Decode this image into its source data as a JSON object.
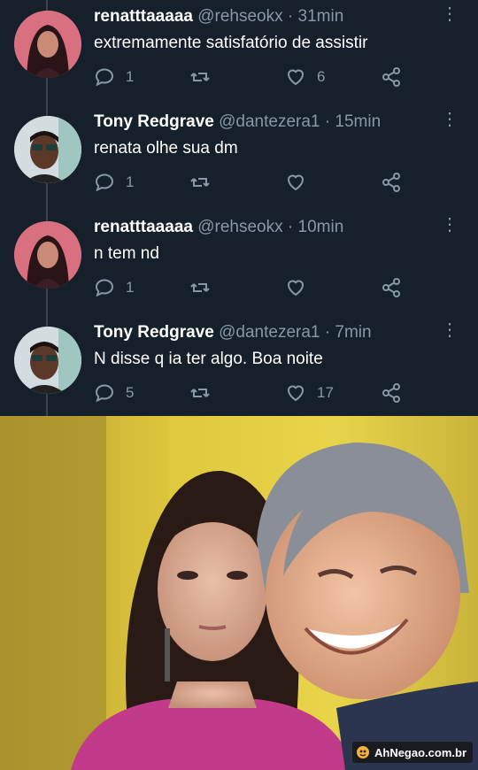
{
  "tweets": [
    {
      "name": "renatttaaaaa",
      "handle": "@rehseokx",
      "time": "· 31min",
      "text": "extremamente satisfatório de assistir",
      "replies": "1",
      "retweets": "",
      "likes": "6"
    },
    {
      "name": "Tony Redgrave",
      "handle": "@dantezera1",
      "time": "· 15min",
      "text": "renata olhe sua dm",
      "replies": "1",
      "retweets": "",
      "likes": ""
    },
    {
      "name": "renatttaaaaa",
      "handle": "@rehseokx",
      "time": "· 10min",
      "text": "n tem nd",
      "replies": "1",
      "retweets": "",
      "likes": ""
    },
    {
      "name": "Tony Redgrave",
      "handle": "@dantezera1",
      "time": "· 7min",
      "text": "N disse q ia ter algo. Boa noite",
      "replies": "5",
      "retweets": "",
      "likes": "17"
    }
  ],
  "icons": {
    "more": "more-vertical-icon",
    "reply": "reply-icon",
    "retweet": "retweet-icon",
    "like": "heart-icon",
    "share": "share-icon"
  },
  "colors": {
    "background": "#15202b",
    "secondary_text": "#8899a6",
    "thread_line": "#38444d"
  },
  "watermark": {
    "text": "AhNegao.com.br"
  }
}
